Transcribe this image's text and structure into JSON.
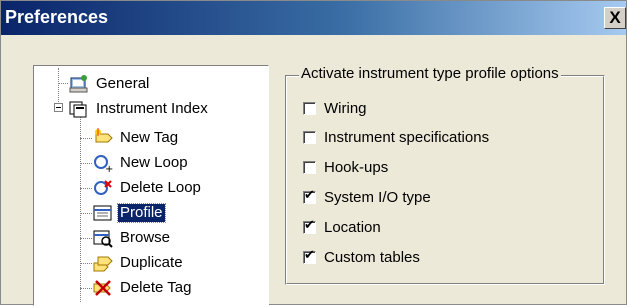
{
  "window": {
    "title": "Preferences",
    "close_label": "X"
  },
  "tree": {
    "items": [
      {
        "label": "General",
        "icon": "general-settings-icon"
      },
      {
        "label": "Instrument Index",
        "icon": "instrument-index-icon"
      },
      {
        "label": "New Tag",
        "icon": "new-tag-icon"
      },
      {
        "label": "New Loop",
        "icon": "new-loop-icon"
      },
      {
        "label": "Delete Loop",
        "icon": "delete-loop-icon"
      },
      {
        "label": "Profile",
        "icon": "profile-icon",
        "selected": true
      },
      {
        "label": "Browse",
        "icon": "browse-icon"
      },
      {
        "label": "Duplicate",
        "icon": "duplicate-icon"
      },
      {
        "label": "Delete Tag",
        "icon": "delete-tag-icon"
      }
    ]
  },
  "options": {
    "legend": "Activate instrument type profile options",
    "items": [
      {
        "label": "Wiring",
        "checked": false
      },
      {
        "label": "Instrument specifications",
        "checked": false
      },
      {
        "label": "Hook-ups",
        "checked": false
      },
      {
        "label": "System I/O type",
        "checked": true
      },
      {
        "label": "Location",
        "checked": true
      },
      {
        "label": "Custom tables",
        "checked": true
      }
    ]
  }
}
